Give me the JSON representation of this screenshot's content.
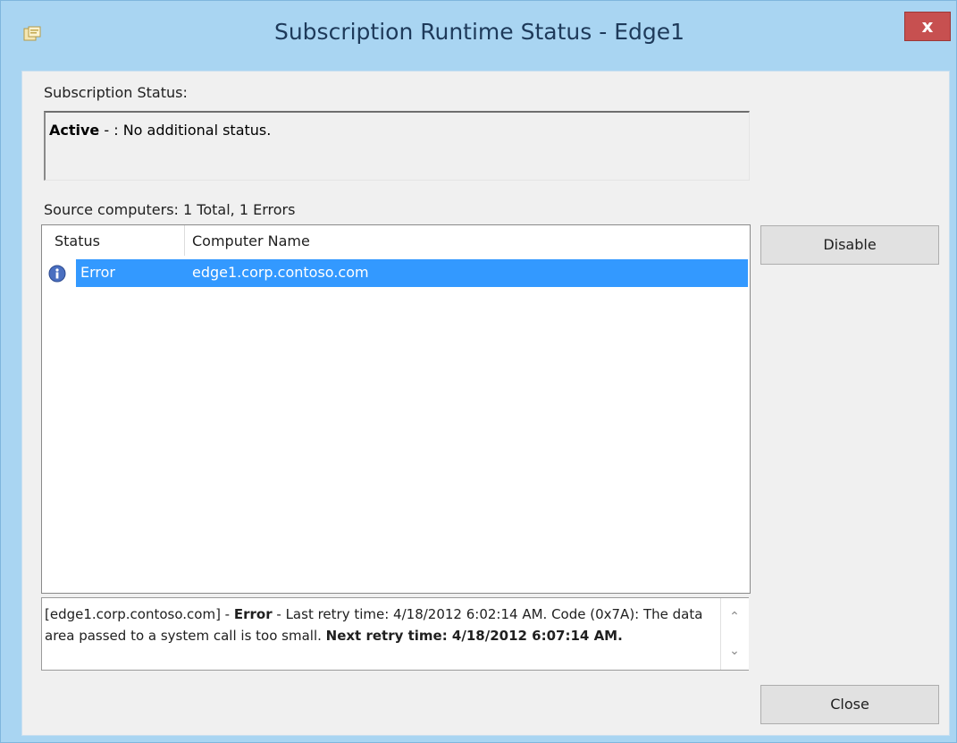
{
  "window": {
    "title": "Subscription Runtime Status - Edge1",
    "close_glyph": "x",
    "app_icon": "subscription-icon"
  },
  "subscription_status": {
    "label": "Subscription Status:",
    "state": "Active",
    "text": " - : No additional status."
  },
  "source_computers": {
    "label": "Source computers: 1 Total, 1 Errors"
  },
  "list": {
    "columns": [
      "Status",
      "Computer Name"
    ],
    "rows": [
      {
        "status": "Error",
        "computer": "edge1.corp.contoso.com",
        "icon": "error-info-icon",
        "selected": true
      }
    ]
  },
  "detail": {
    "prefix": "[edge1.corp.contoso.com] - ",
    "error_label": "Error",
    "middle": " - Last retry time: 4/18/2012 6:02:14 AM. Code (0x7A): The data area passed to a system call is too small.  ",
    "next_label": "Next retry time: 4/18/2012 6:07:14 AM."
  },
  "buttons": {
    "disable": "Disable",
    "close": "Close"
  },
  "colors": {
    "selection": "#3399ff",
    "frame": "#a9d5f2",
    "close_button": "#c75050"
  }
}
